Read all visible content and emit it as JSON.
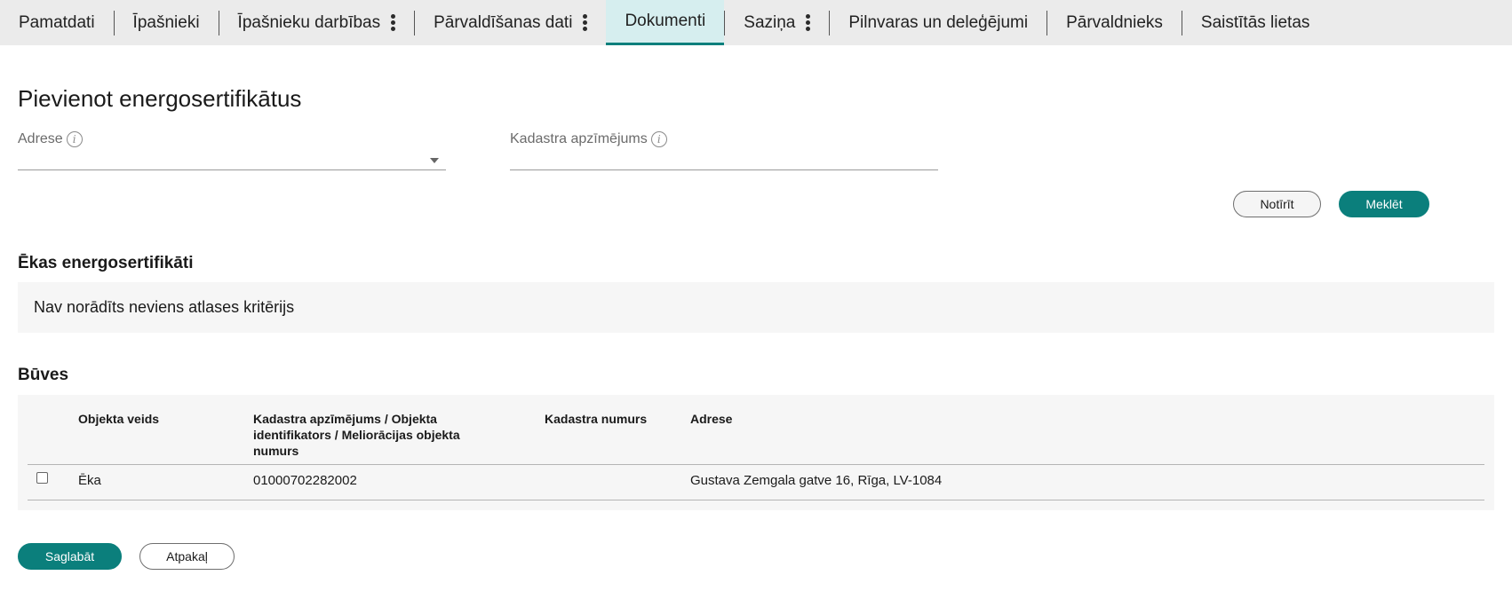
{
  "tabs": [
    {
      "label": "Pamatdati"
    },
    {
      "label": "Īpašnieki"
    },
    {
      "label": "Īpašnieku darbības"
    },
    {
      "label": "Pārvaldīšanas dati"
    },
    {
      "label": "Dokumenti"
    },
    {
      "label": "Saziņa"
    },
    {
      "label": "Pilnvaras un deleģējumi"
    },
    {
      "label": "Pārvaldnieks"
    },
    {
      "label": "Saistītās lietas"
    }
  ],
  "active_tab": "Dokumenti",
  "page_title": "Pievienot energosertifikātus",
  "form": {
    "address_label": "Adrese",
    "address_value": "",
    "cadastre_label": "Kadastra apzīmējums",
    "cadastre_value": "",
    "info_glyph": "i",
    "clear_button": "Notīrīt",
    "search_button": "Meklēt"
  },
  "certificates": {
    "title": "Ēkas energosertifikāti",
    "empty_text": "Nav norādīts neviens atlases kritērijs"
  },
  "buildings": {
    "title": "Būves",
    "columns": [
      "Objekta veids",
      "Kadastra apzīmējums / Objekta identifikators / Meliorācijas objekta numurs",
      "Kadastra numurs",
      "Adrese"
    ],
    "rows": [
      {
        "type": "Ēka",
        "designation": "01000702282002",
        "number": "",
        "address": "Gustava Zemgala gatve 16, Rīga, LV-1084",
        "checked": false
      }
    ]
  },
  "footer": {
    "save_button": "Saglabāt",
    "back_button": "Atpakaļ"
  },
  "colors": {
    "accent": "#0b7f7c",
    "active_tab_bg": "#d6eeef",
    "tabbar_bg": "#ebebeb"
  }
}
